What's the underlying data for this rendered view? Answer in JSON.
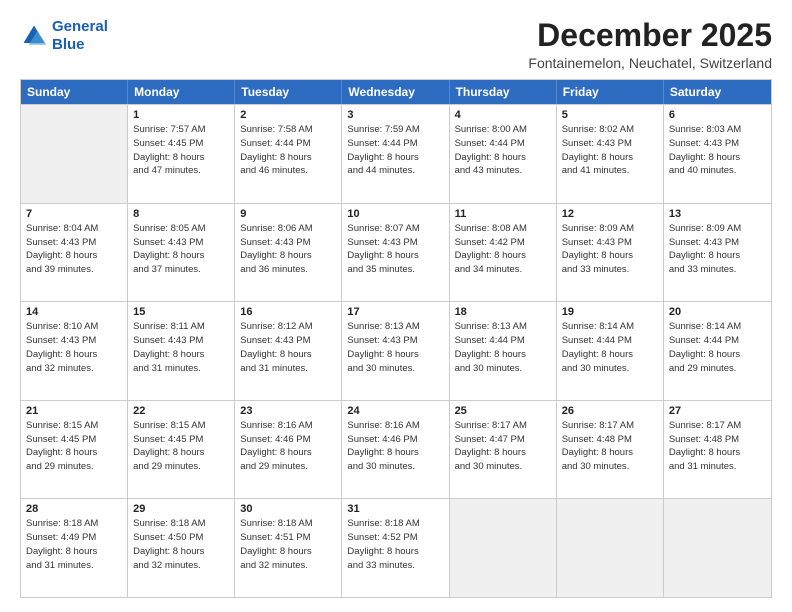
{
  "logo": {
    "line1": "General",
    "line2": "Blue"
  },
  "title": "December 2025",
  "location": "Fontainemelon, Neuchatel, Switzerland",
  "days_of_week": [
    "Sunday",
    "Monday",
    "Tuesday",
    "Wednesday",
    "Thursday",
    "Friday",
    "Saturday"
  ],
  "weeks": [
    [
      {
        "day": "",
        "info": "",
        "shaded": true
      },
      {
        "day": "1",
        "info": "Sunrise: 7:57 AM\nSunset: 4:45 PM\nDaylight: 8 hours\nand 47 minutes.",
        "shaded": false
      },
      {
        "day": "2",
        "info": "Sunrise: 7:58 AM\nSunset: 4:44 PM\nDaylight: 8 hours\nand 46 minutes.",
        "shaded": false
      },
      {
        "day": "3",
        "info": "Sunrise: 7:59 AM\nSunset: 4:44 PM\nDaylight: 8 hours\nand 44 minutes.",
        "shaded": false
      },
      {
        "day": "4",
        "info": "Sunrise: 8:00 AM\nSunset: 4:44 PM\nDaylight: 8 hours\nand 43 minutes.",
        "shaded": false
      },
      {
        "day": "5",
        "info": "Sunrise: 8:02 AM\nSunset: 4:43 PM\nDaylight: 8 hours\nand 41 minutes.",
        "shaded": false
      },
      {
        "day": "6",
        "info": "Sunrise: 8:03 AM\nSunset: 4:43 PM\nDaylight: 8 hours\nand 40 minutes.",
        "shaded": false
      }
    ],
    [
      {
        "day": "7",
        "info": "Sunrise: 8:04 AM\nSunset: 4:43 PM\nDaylight: 8 hours\nand 39 minutes.",
        "shaded": false
      },
      {
        "day": "8",
        "info": "Sunrise: 8:05 AM\nSunset: 4:43 PM\nDaylight: 8 hours\nand 37 minutes.",
        "shaded": false
      },
      {
        "day": "9",
        "info": "Sunrise: 8:06 AM\nSunset: 4:43 PM\nDaylight: 8 hours\nand 36 minutes.",
        "shaded": false
      },
      {
        "day": "10",
        "info": "Sunrise: 8:07 AM\nSunset: 4:43 PM\nDaylight: 8 hours\nand 35 minutes.",
        "shaded": false
      },
      {
        "day": "11",
        "info": "Sunrise: 8:08 AM\nSunset: 4:42 PM\nDaylight: 8 hours\nand 34 minutes.",
        "shaded": false
      },
      {
        "day": "12",
        "info": "Sunrise: 8:09 AM\nSunset: 4:43 PM\nDaylight: 8 hours\nand 33 minutes.",
        "shaded": false
      },
      {
        "day": "13",
        "info": "Sunrise: 8:09 AM\nSunset: 4:43 PM\nDaylight: 8 hours\nand 33 minutes.",
        "shaded": false
      }
    ],
    [
      {
        "day": "14",
        "info": "Sunrise: 8:10 AM\nSunset: 4:43 PM\nDaylight: 8 hours\nand 32 minutes.",
        "shaded": false
      },
      {
        "day": "15",
        "info": "Sunrise: 8:11 AM\nSunset: 4:43 PM\nDaylight: 8 hours\nand 31 minutes.",
        "shaded": false
      },
      {
        "day": "16",
        "info": "Sunrise: 8:12 AM\nSunset: 4:43 PM\nDaylight: 8 hours\nand 31 minutes.",
        "shaded": false
      },
      {
        "day": "17",
        "info": "Sunrise: 8:13 AM\nSunset: 4:43 PM\nDaylight: 8 hours\nand 30 minutes.",
        "shaded": false
      },
      {
        "day": "18",
        "info": "Sunrise: 8:13 AM\nSunset: 4:44 PM\nDaylight: 8 hours\nand 30 minutes.",
        "shaded": false
      },
      {
        "day": "19",
        "info": "Sunrise: 8:14 AM\nSunset: 4:44 PM\nDaylight: 8 hours\nand 30 minutes.",
        "shaded": false
      },
      {
        "day": "20",
        "info": "Sunrise: 8:14 AM\nSunset: 4:44 PM\nDaylight: 8 hours\nand 29 minutes.",
        "shaded": false
      }
    ],
    [
      {
        "day": "21",
        "info": "Sunrise: 8:15 AM\nSunset: 4:45 PM\nDaylight: 8 hours\nand 29 minutes.",
        "shaded": false
      },
      {
        "day": "22",
        "info": "Sunrise: 8:15 AM\nSunset: 4:45 PM\nDaylight: 8 hours\nand 29 minutes.",
        "shaded": false
      },
      {
        "day": "23",
        "info": "Sunrise: 8:16 AM\nSunset: 4:46 PM\nDaylight: 8 hours\nand 29 minutes.",
        "shaded": false
      },
      {
        "day": "24",
        "info": "Sunrise: 8:16 AM\nSunset: 4:46 PM\nDaylight: 8 hours\nand 30 minutes.",
        "shaded": false
      },
      {
        "day": "25",
        "info": "Sunrise: 8:17 AM\nSunset: 4:47 PM\nDaylight: 8 hours\nand 30 minutes.",
        "shaded": false
      },
      {
        "day": "26",
        "info": "Sunrise: 8:17 AM\nSunset: 4:48 PM\nDaylight: 8 hours\nand 30 minutes.",
        "shaded": false
      },
      {
        "day": "27",
        "info": "Sunrise: 8:17 AM\nSunset: 4:48 PM\nDaylight: 8 hours\nand 31 minutes.",
        "shaded": false
      }
    ],
    [
      {
        "day": "28",
        "info": "Sunrise: 8:18 AM\nSunset: 4:49 PM\nDaylight: 8 hours\nand 31 minutes.",
        "shaded": false
      },
      {
        "day": "29",
        "info": "Sunrise: 8:18 AM\nSunset: 4:50 PM\nDaylight: 8 hours\nand 32 minutes.",
        "shaded": false
      },
      {
        "day": "30",
        "info": "Sunrise: 8:18 AM\nSunset: 4:51 PM\nDaylight: 8 hours\nand 32 minutes.",
        "shaded": false
      },
      {
        "day": "31",
        "info": "Sunrise: 8:18 AM\nSunset: 4:52 PM\nDaylight: 8 hours\nand 33 minutes.",
        "shaded": false
      },
      {
        "day": "",
        "info": "",
        "shaded": true
      },
      {
        "day": "",
        "info": "",
        "shaded": true
      },
      {
        "day": "",
        "info": "",
        "shaded": true
      }
    ]
  ]
}
